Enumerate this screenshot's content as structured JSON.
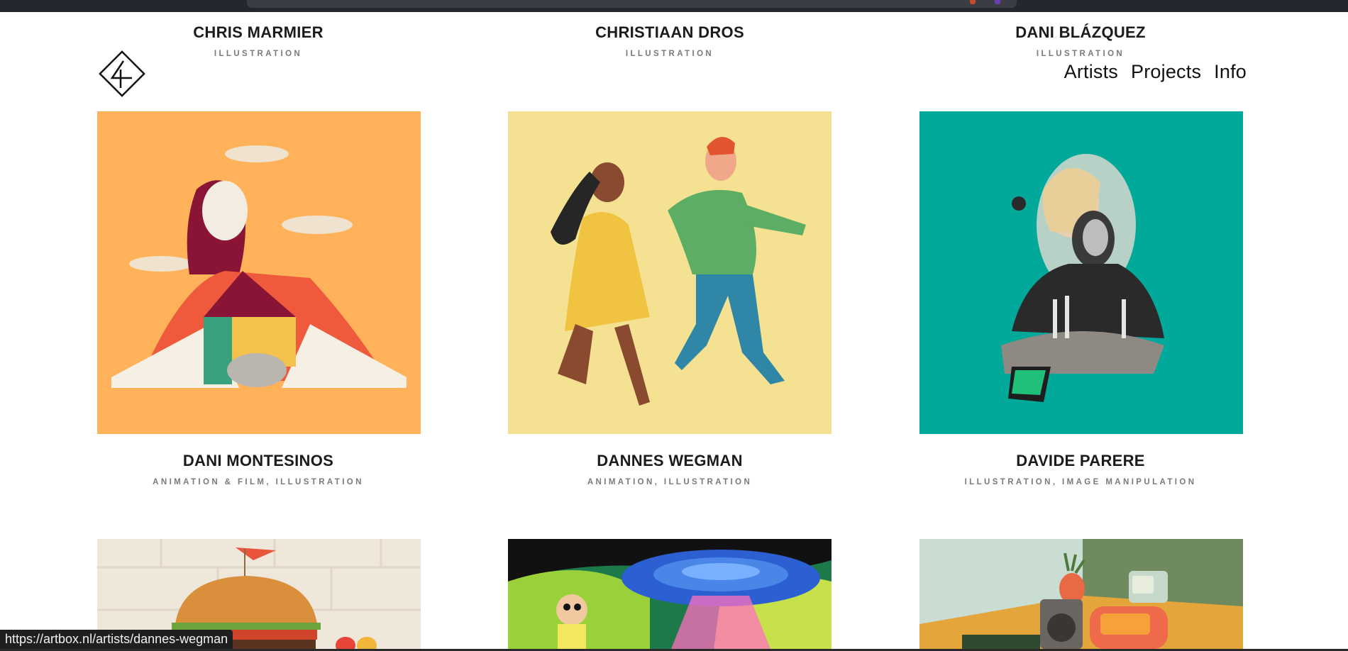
{
  "nav": {
    "items": [
      "Artists",
      "Projects",
      "Info"
    ]
  },
  "logo": {
    "icon": "artbox-logo-icon"
  },
  "top_row": [
    {
      "name": "CHRIS MARMIER",
      "tags": "ILLUSTRATION"
    },
    {
      "name": "CHRISTIAAN DROS",
      "tags": "ILLUSTRATION"
    },
    {
      "name": "DANI BLÁZQUEZ",
      "tags": "ILLUSTRATION"
    }
  ],
  "main_row": [
    {
      "name": "DANI MONTESINOS",
      "tags": "ANIMATION & FILM, ILLUSTRATION",
      "bg": "#ffb25a"
    },
    {
      "name": "DANNES WEGMAN",
      "tags": "ANIMATION, ILLUSTRATION",
      "bg": "#f4e292"
    },
    {
      "name": "DAVIDE PARERE",
      "tags": "ILLUSTRATION, IMAGE MANIPULATION",
      "bg": "#00a99a"
    }
  ],
  "bottom_row": [
    {
      "bg": "#efe7da"
    },
    {
      "bg": "#1c7a4a"
    },
    {
      "bg": "#a9c4b2"
    }
  ],
  "status": {
    "url": "https://artbox.nl/artists/dannes-wegman"
  },
  "colors": {
    "text": "#1b1b1b",
    "tags": "#7a7a7a",
    "statusbar": "#1f1f1f"
  }
}
